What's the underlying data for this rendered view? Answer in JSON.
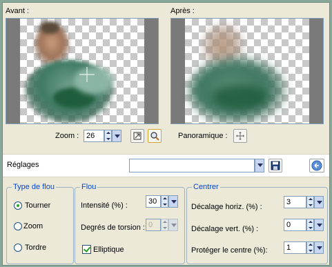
{
  "preview": {
    "before_label": "Avant :",
    "after_label": "Après :"
  },
  "zoom": {
    "label": "Zoom :",
    "value": "26"
  },
  "pan": {
    "label": "Panoramique :"
  },
  "settings": {
    "label": "Réglages",
    "preset_value": ""
  },
  "blur_type": {
    "title": "Type de flou",
    "options": [
      "Tourner",
      "Zoom",
      "Tordre"
    ],
    "selected": "Tourner"
  },
  "blur": {
    "title": "Flou",
    "intensity_label": "Intensité (%) :",
    "intensity_value": "30",
    "torsion_label": "Degrés de torsion :",
    "torsion_value": "0",
    "elliptic_label": "Elliptique",
    "elliptic_checked": true
  },
  "center": {
    "title": "Centrer",
    "hshift_label": "Décalage horiz. (%) :",
    "hshift_value": "3",
    "vshift_label": "Décalage vert. (%) :",
    "vshift_value": "0",
    "protect_label": "Protéger le centre (%):",
    "protect_value": "1"
  },
  "colors": {
    "accent": "#0046d5",
    "dialog_bg": "#ece9d8",
    "frame_bg": "#8aa89a"
  }
}
